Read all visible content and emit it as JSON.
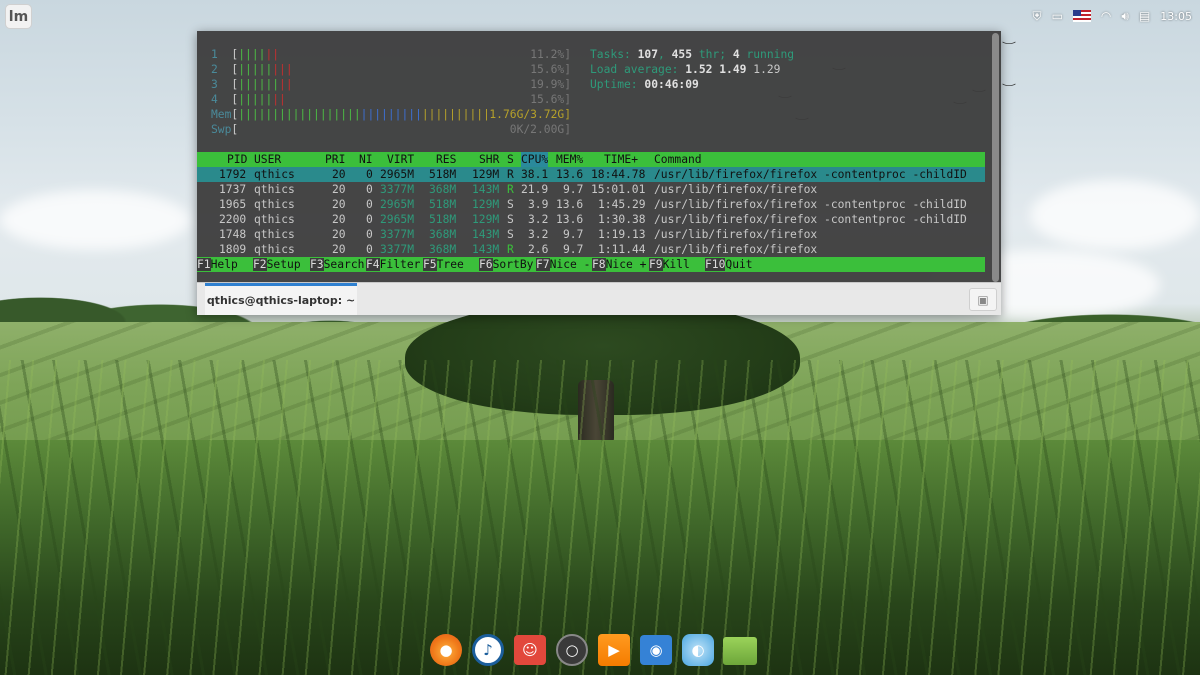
{
  "panel": {
    "menu_icon": "linux-mint-logo",
    "tray_icons": [
      "shield-icon",
      "network-card-icon",
      "us-flag-icon",
      "wifi-icon",
      "volume-icon",
      "clipboard-icon"
    ],
    "clock": "13:05"
  },
  "htop": {
    "cpu_meters": [
      {
        "label": "1",
        "bars": "[||||||",
        "pct": "11.2%]"
      },
      {
        "label": "2",
        "bars": "[||||||||",
        "pct": "15.6%]"
      },
      {
        "label": "3",
        "bars": "[||||||||",
        "pct": "19.9%]"
      },
      {
        "label": "4",
        "bars": "[|||||||",
        "pct": "15.6%]"
      }
    ],
    "mem": {
      "label": "Mem",
      "bars": "[|||||||||||||||||||||||||||||||||||||||",
      "value": "1.76G/3.72G]"
    },
    "swp": {
      "label": "Swp",
      "bars": "[",
      "value": "0K/2.00G]"
    },
    "stats": {
      "tasks_label": "Tasks: ",
      "tasks": "107",
      "sep": ", ",
      "threads": "455",
      "thr_label": " thr; ",
      "running": "4",
      "running_label": " running",
      "load_label": "Load average: ",
      "load1": "1.52",
      "load5": "1.49",
      "load15": "1.29",
      "uptime_label": "Uptime: ",
      "uptime": "00:46:09"
    },
    "columns": [
      "PID",
      "USER",
      "PRI",
      "NI",
      "VIRT",
      "RES",
      "SHR",
      "S",
      "CPU%",
      "MEM%",
      "TIME+",
      "Command"
    ],
    "processes": [
      {
        "pid": "1792",
        "user": "qthics",
        "pri": "20",
        "ni": "0",
        "virt": "2965M",
        "res": "518M",
        "shr": "129M",
        "s": "R",
        "cpu": "38.1",
        "mem": "13.6",
        "time": "18:44.78",
        "cmd": "/usr/lib/firefox/firefox -contentproc -childID"
      },
      {
        "pid": "1737",
        "user": "qthics",
        "pri": "20",
        "ni": "0",
        "virt": "3377M",
        "res": "368M",
        "shr": "143M",
        "s": "R",
        "cpu": "21.9",
        "mem": "9.7",
        "time": "15:01.01",
        "cmd": "/usr/lib/firefox/firefox"
      },
      {
        "pid": "1965",
        "user": "qthics",
        "pri": "20",
        "ni": "0",
        "virt": "2965M",
        "res": "518M",
        "shr": "129M",
        "s": "S",
        "cpu": "3.9",
        "mem": "13.6",
        "time": "1:45.29",
        "cmd": "/usr/lib/firefox/firefox -contentproc -childID"
      },
      {
        "pid": "2200",
        "user": "qthics",
        "pri": "20",
        "ni": "0",
        "virt": "2965M",
        "res": "518M",
        "shr": "129M",
        "s": "S",
        "cpu": "3.2",
        "mem": "13.6",
        "time": "1:30.38",
        "cmd": "/usr/lib/firefox/firefox -contentproc -childID"
      },
      {
        "pid": "1748",
        "user": "qthics",
        "pri": "20",
        "ni": "0",
        "virt": "3377M",
        "res": "368M",
        "shr": "143M",
        "s": "S",
        "cpu": "3.2",
        "mem": "9.7",
        "time": "1:19.13",
        "cmd": "/usr/lib/firefox/firefox"
      },
      {
        "pid": "1809",
        "user": "qthics",
        "pri": "20",
        "ni": "0",
        "virt": "3377M",
        "res": "368M",
        "shr": "143M",
        "s": "R",
        "cpu": "2.6",
        "mem": "9.7",
        "time": "1:11.44",
        "cmd": "/usr/lib/firefox/firefox"
      }
    ],
    "fkeys": [
      {
        "key": "F1",
        "label": "Help  "
      },
      {
        "key": "F2",
        "label": "Setup "
      },
      {
        "key": "F3",
        "label": "Search"
      },
      {
        "key": "F4",
        "label": "Filter"
      },
      {
        "key": "F5",
        "label": "Tree  "
      },
      {
        "key": "F6",
        "label": "SortBy"
      },
      {
        "key": "F7",
        "label": "Nice -"
      },
      {
        "key": "F8",
        "label": "Nice +"
      },
      {
        "key": "F9",
        "label": "Kill  "
      },
      {
        "key": "F10",
        "label": "Quit"
      }
    ]
  },
  "terminal": {
    "tab_title": "qthics@qthics-laptop: ~",
    "new_tab_icon": "new-tab-icon"
  },
  "dock": {
    "apps": [
      "firefox-icon",
      "rhythmbox-icon",
      "gimp-icon",
      "obs-icon",
      "vlc-icon",
      "screenshot-icon",
      "browser-icon",
      "files-icon"
    ]
  }
}
